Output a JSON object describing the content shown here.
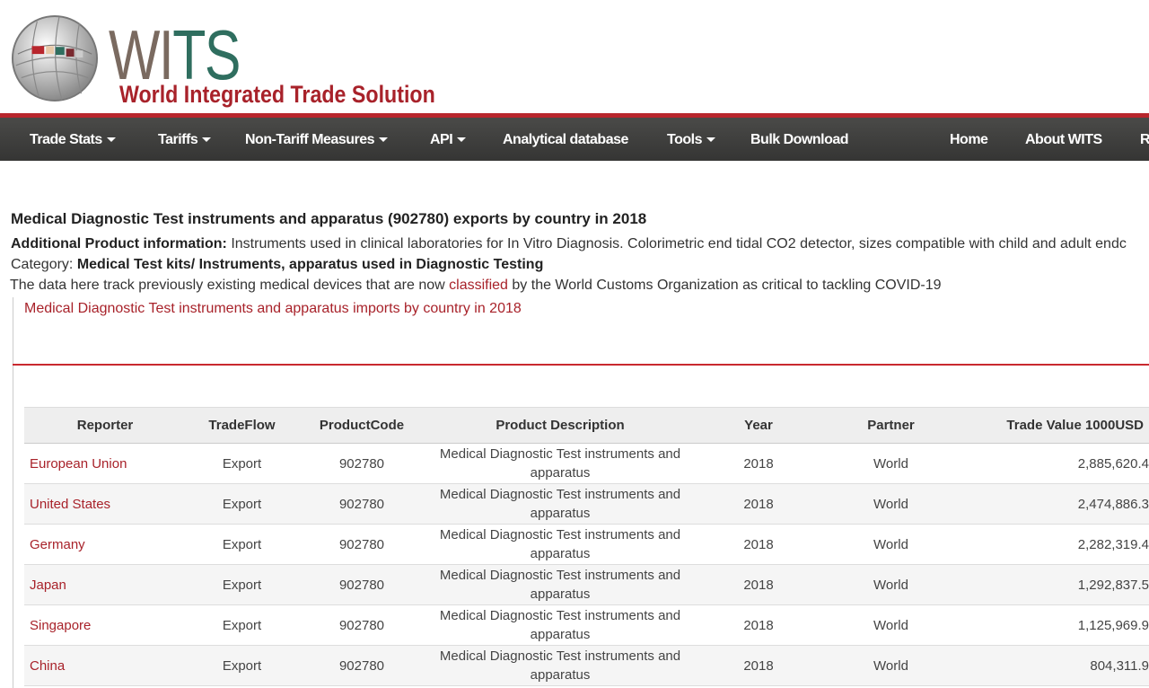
{
  "logo": {
    "letters": [
      "W",
      "I",
      "T",
      "S"
    ],
    "subtitle": "World Integrated Trade Solution"
  },
  "nav": {
    "items": [
      {
        "label": "Trade Stats",
        "dropdown": true
      },
      {
        "label": "Tariffs",
        "dropdown": true
      },
      {
        "label": "Non-Tariff Measures",
        "dropdown": true
      },
      {
        "label": "API",
        "dropdown": true
      },
      {
        "label": "Analytical database",
        "dropdown": false
      },
      {
        "label": "Tools",
        "dropdown": true
      },
      {
        "label": "Bulk Download",
        "dropdown": false
      },
      {
        "label": "Home",
        "dropdown": false
      },
      {
        "label": "About WITS",
        "dropdown": false
      },
      {
        "label": "R",
        "dropdown": false
      }
    ]
  },
  "page": {
    "title": "Medical Diagnostic Test instruments and apparatus (902780) exports by country in 2018",
    "additional_label": "Additional Product information:",
    "additional_text": "Instruments used in clinical laboratories for In Vitro Diagnosis. Colorimetric end tidal CO2 detector, sizes compatible with child and adult endc",
    "category_label": "Category:",
    "category_value": "Medical Test kits/ Instruments, apparatus used in Diagnostic Testing",
    "note_before": "The data here track previously existing medical devices that are now ",
    "note_link": "classified",
    "note_after": " by the World Customs Organization as critical to tackling COVID-19",
    "imports_link": "Medical Diagnostic Test instruments and apparatus imports by country in 2018"
  },
  "table": {
    "headers": [
      "Reporter",
      "TradeFlow",
      "ProductCode",
      "Product Description",
      "Year",
      "Partner",
      "Trade Value 1000USD"
    ],
    "rows": [
      {
        "reporter": "European Union",
        "flow": "Export",
        "code": "902780",
        "desc": "Medical Diagnostic Test instruments and apparatus",
        "year": "2018",
        "partner": "World",
        "value": "2,885,620.4"
      },
      {
        "reporter": "United States",
        "flow": "Export",
        "code": "902780",
        "desc": "Medical Diagnostic Test instruments and apparatus",
        "year": "2018",
        "partner": "World",
        "value": "2,474,886.3"
      },
      {
        "reporter": "Germany",
        "flow": "Export",
        "code": "902780",
        "desc": "Medical Diagnostic Test instruments and apparatus",
        "year": "2018",
        "partner": "World",
        "value": "2,282,319.4"
      },
      {
        "reporter": "Japan",
        "flow": "Export",
        "code": "902780",
        "desc": "Medical Diagnostic Test instruments and apparatus",
        "year": "2018",
        "partner": "World",
        "value": "1,292,837.5"
      },
      {
        "reporter": "Singapore",
        "flow": "Export",
        "code": "902780",
        "desc": "Medical Diagnostic Test instruments and apparatus",
        "year": "2018",
        "partner": "World",
        "value": "1,125,969.9"
      },
      {
        "reporter": "China",
        "flow": "Export",
        "code": "902780",
        "desc": "Medical Diagnostic Test instruments and apparatus",
        "year": "2018",
        "partner": "World",
        "value": "804,311.9"
      }
    ]
  },
  "colors": {
    "brand_red": "#a8222a",
    "nav_bg": "#3c3c3b",
    "logo_green": "#2f6e5f"
  }
}
